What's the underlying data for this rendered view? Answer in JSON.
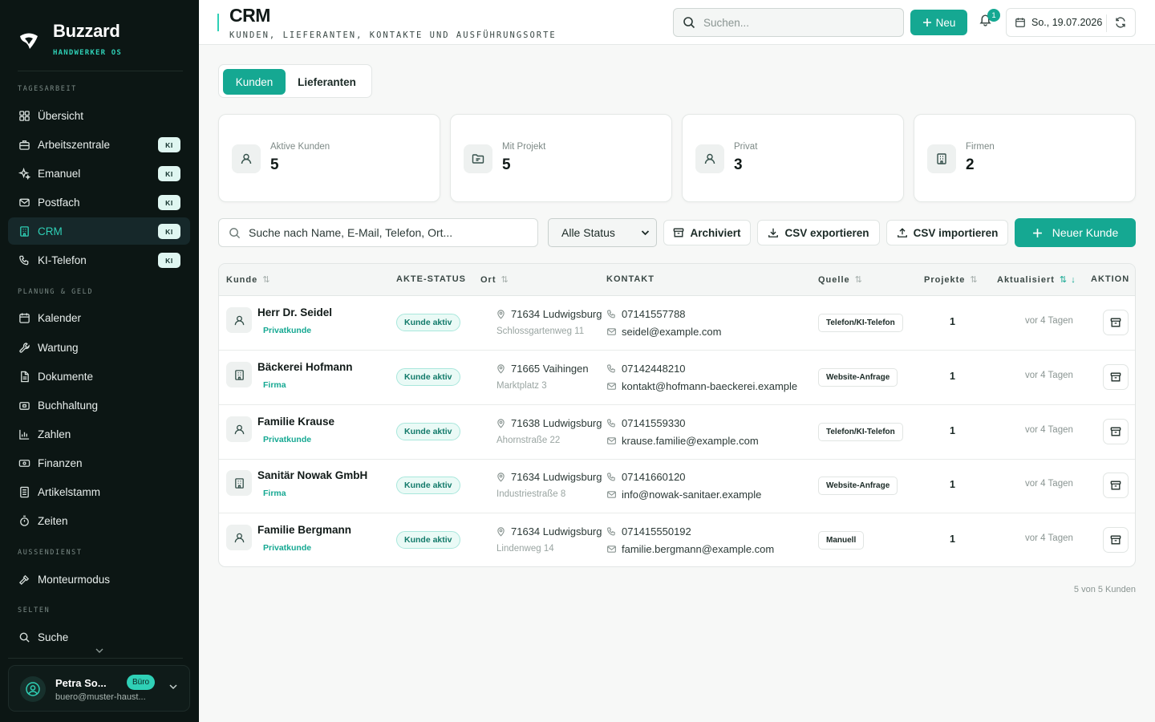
{
  "brand": {
    "name": "Buzzard",
    "subtitle": "HANDWERKER OS"
  },
  "sidebar": {
    "sections": {
      "tagesarbeit": "TAGESARBEIT",
      "planung": "PLANUNG & GELD",
      "aussendienst": "AUSSENDIENST",
      "selten": "SELTEN"
    },
    "items": [
      {
        "label": "Übersicht",
        "icon": "grid-icon",
        "badge": ""
      },
      {
        "label": "Arbeitszentrale",
        "icon": "briefcase-icon",
        "badge": "KI"
      },
      {
        "label": "Emanuel",
        "icon": "sparkle-icon",
        "badge": "KI"
      },
      {
        "label": "Postfach",
        "icon": "mail-icon",
        "badge": "KI"
      },
      {
        "label": "CRM",
        "icon": "building-icon",
        "badge": "KI",
        "active": true
      },
      {
        "label": "KI-Telefon",
        "icon": "phone-icon",
        "badge": "KI"
      },
      {
        "label": "Kalender",
        "icon": "calendar-icon",
        "badge": ""
      },
      {
        "label": "Wartung",
        "icon": "wrench-icon",
        "badge": ""
      },
      {
        "label": "Dokumente",
        "icon": "document-icon",
        "badge": ""
      },
      {
        "label": "Buchhaltung",
        "icon": "wallet-icon",
        "badge": ""
      },
      {
        "label": "Zahlen",
        "icon": "bar-chart-icon",
        "badge": ""
      },
      {
        "label": "Finanzen",
        "icon": "banknote-icon",
        "badge": ""
      },
      {
        "label": "Artikelstamm",
        "icon": "list-icon",
        "badge": ""
      },
      {
        "label": "Zeiten",
        "icon": "timer-icon",
        "badge": ""
      },
      {
        "label": "Monteurmodus",
        "icon": "hammer-icon",
        "badge": ""
      },
      {
        "label": "Suche",
        "icon": "search-icon",
        "badge": ""
      }
    ],
    "user": {
      "name": "Petra So...",
      "email": "buero@muster-haust...",
      "role": "Büro"
    }
  },
  "header": {
    "title": "CRM",
    "subtitle": "KUNDEN, LIEFERANTEN, KONTAKTE UND AUSFÜHRUNGSORTE",
    "search_placeholder": "Suchen...",
    "new_label": "Neu",
    "notification_count": "1",
    "date": "So., 19.07.2026"
  },
  "tabs": {
    "kunden": "Kunden",
    "lieferanten": "Lieferanten"
  },
  "stats": [
    {
      "label": "Aktive Kunden",
      "value": "5",
      "icon": "user-icon"
    },
    {
      "label": "Mit Projekt",
      "value": "5",
      "icon": "folder-icon"
    },
    {
      "label": "Privat",
      "value": "3",
      "icon": "user-icon"
    },
    {
      "label": "Firmen",
      "value": "2",
      "icon": "building-icon"
    }
  ],
  "toolbar": {
    "search_placeholder": "Suche nach Name, E-Mail, Telefon, Ort...",
    "status_filter": "Alle Status",
    "archived": "Archiviert",
    "export_csv": "CSV exportieren",
    "import_csv": "CSV importieren",
    "new_customer": "Neuer Kunde"
  },
  "table": {
    "headers": {
      "kunde": "Kunde",
      "status": "AKTE-STATUS",
      "ort": "Ort",
      "kontakt": "KONTAKT",
      "quelle": "Quelle",
      "projekte": "Projekte",
      "aktualisiert": "Aktualisiert",
      "aktion": "AKTION"
    },
    "rows": [
      {
        "name": "Herr Dr. Seidel",
        "type": "Privatkunde",
        "status": "Kunde aktiv",
        "city": "71634 Ludwigsburg",
        "street": "Schlossgartenweg 11",
        "phone": "07141557788",
        "email": "seidel@example.com",
        "source": "Telefon/KI-Telefon",
        "projects": "1",
        "updated": "vor 4 Tagen",
        "icon": "user-icon"
      },
      {
        "name": "Bäckerei Hofmann",
        "type": "Firma",
        "status": "Kunde aktiv",
        "city": "71665 Vaihingen",
        "street": "Marktplatz 3",
        "phone": "07142448210",
        "email": "kontakt@hofmann-baeckerei.example",
        "source": "Website-Anfrage",
        "projects": "1",
        "updated": "vor 4 Tagen",
        "icon": "building-icon"
      },
      {
        "name": "Familie Krause",
        "type": "Privatkunde",
        "status": "Kunde aktiv",
        "city": "71638 Ludwigsburg",
        "street": "Ahornstraße 22",
        "phone": "07141559330",
        "email": "krause.familie@example.com",
        "source": "Telefon/KI-Telefon",
        "projects": "1",
        "updated": "vor 4 Tagen",
        "icon": "user-icon"
      },
      {
        "name": "Sanitär Nowak GmbH",
        "type": "Firma",
        "status": "Kunde aktiv",
        "city": "71634 Ludwigsburg",
        "street": "Industriestraße 8",
        "phone": "07141660120",
        "email": "info@nowak-sanitaer.example",
        "source": "Website-Anfrage",
        "projects": "1",
        "updated": "vor 4 Tagen",
        "icon": "building-icon"
      },
      {
        "name": "Familie Bergmann",
        "type": "Privatkunde",
        "status": "Kunde aktiv",
        "city": "71634 Ludwigsburg",
        "street": "Lindenweg 14",
        "phone": "071415550192",
        "email": "familie.bergmann@example.com",
        "source": "Manuell",
        "projects": "1",
        "updated": "vor 4 Tagen",
        "icon": "user-icon"
      }
    ],
    "footer": "5 von 5 Kunden"
  },
  "colors": {
    "accent": "#15a892",
    "accent_light": "#2fd0b6",
    "sidebar_bg": "#0c1614"
  }
}
